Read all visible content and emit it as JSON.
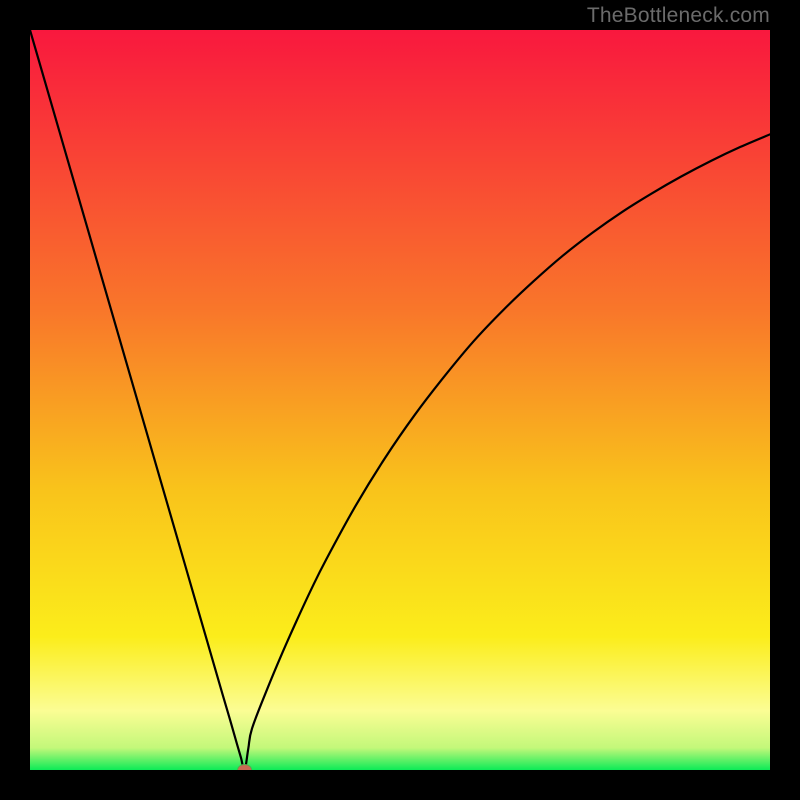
{
  "watermark": "TheBottleneck.com",
  "colors": {
    "frame": "#000000",
    "gradient_top": "#f9183e",
    "gradient_mid": "#f9a91b",
    "gradient_yellow": "#fbed1b",
    "gradient_paleyellow": "#fbfd94",
    "gradient_bottom": "#0ceb57",
    "curve": "#000000",
    "marker_fill": "#c96a52",
    "marker_stroke": "#5aa84f"
  },
  "chart_data": {
    "type": "line",
    "title": "",
    "xlabel": "",
    "ylabel": "",
    "xlim": [
      0,
      100
    ],
    "ylim": [
      0,
      100
    ],
    "x": [
      0,
      2,
      4,
      6,
      8,
      10,
      12,
      14,
      16,
      18,
      20,
      22,
      24,
      26,
      27,
      28,
      28.5,
      29,
      29.5,
      30,
      32,
      34,
      36,
      38,
      40,
      44,
      48,
      52,
      56,
      60,
      64,
      68,
      72,
      76,
      80,
      84,
      88,
      92,
      96,
      100
    ],
    "values": [
      100,
      93.1,
      86.2,
      79.3,
      72.4,
      65.5,
      58.6,
      51.7,
      44.8,
      37.9,
      31.0,
      24.1,
      17.2,
      10.3,
      6.9,
      3.4,
      1.7,
      0,
      2.9,
      5.6,
      10.8,
      15.6,
      20.1,
      24.4,
      28.4,
      35.7,
      42.2,
      48.0,
      53.2,
      58.0,
      62.2,
      66.0,
      69.5,
      72.6,
      75.4,
      77.9,
      80.2,
      82.3,
      84.2,
      85.9
    ],
    "marker": {
      "x": 29,
      "y": 0
    }
  }
}
